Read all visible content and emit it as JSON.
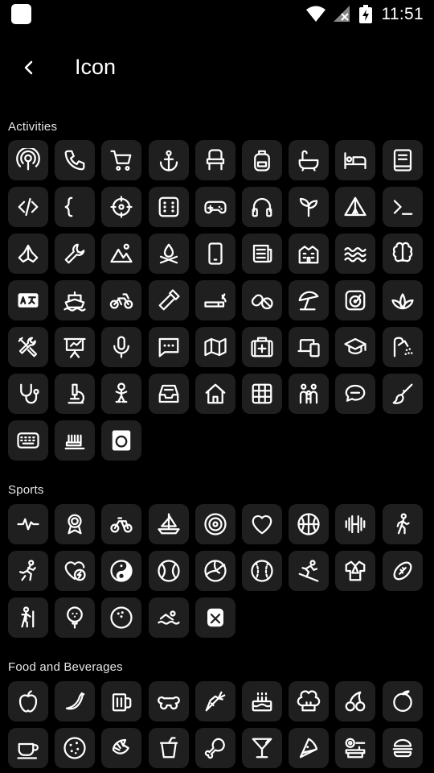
{
  "status_bar": {
    "time": "11:51"
  },
  "app_bar": {
    "title": "Icon"
  },
  "sections": [
    {
      "title": "Activities",
      "icons": [
        "podcast-icon",
        "phone-icon",
        "shopping-cart-icon",
        "anchor-icon",
        "chair-icon",
        "backpack-icon",
        "bathtub-icon",
        "bed-icon",
        "book-icon",
        "code-icon",
        "curly-braces-icon",
        "crosshair-icon",
        "dice-icon",
        "gamepad-icon",
        "headphones-icon",
        "plant-icon",
        "tent-icon",
        "terminal-icon",
        "praying-hands-icon",
        "wrench-icon",
        "mountains-icon",
        "campfire-icon",
        "mobile-phone-icon",
        "newspaper-icon",
        "building-icon",
        "waves-icon",
        "brain-icon",
        "translate-icon",
        "ship-icon",
        "motorcycle-icon",
        "hammer-icon",
        "cigarette-icon",
        "pills-icon",
        "beach-umbrella-icon",
        "vinyl-record-icon",
        "lotus-icon",
        "tools-icon",
        "presentation-icon",
        "microphone-icon",
        "chat-dots-icon",
        "map-icon",
        "first-aid-kit-icon",
        "devices-icon",
        "graduation-cap-icon",
        "shower-icon",
        "stethoscope-icon",
        "microscope-icon",
        "baby-icon",
        "inbox-tray-icon",
        "house-icon",
        "grid-icon",
        "family-icon",
        "chat-bubble-icon",
        "paint-brush-icon",
        "keyboard-icon",
        "toothbrush-icon",
        "washing-machine-icon"
      ]
    },
    {
      "title": "Sports",
      "icons": [
        "heartbeat-icon",
        "medal-icon",
        "bicycle-icon",
        "sailboat-icon",
        "target-icon",
        "heart-icon",
        "basketball-icon",
        "dumbbell-icon",
        "walking-person-icon",
        "running-person-icon",
        "heart-bolt-icon",
        "yin-yang-icon",
        "tennis-ball-icon",
        "volleyball-icon",
        "baseball-icon",
        "skiing-icon",
        "judo-icon",
        "football-icon",
        "hiking-icon",
        "golf-ball-icon",
        "bowling-ball-icon",
        "swimming-icon",
        "boxing-glove-icon"
      ]
    },
    {
      "title": "Food and Beverages",
      "icons": [
        "apple-icon",
        "banana-icon",
        "beer-mug-icon",
        "bone-icon",
        "carrot-icon",
        "cake-icon",
        "chef-hat-icon",
        "cherries-icon",
        "orange-icon",
        "coffee-cup-icon",
        "cookie-icon",
        "croissant-icon",
        "drink-cup-icon",
        "chicken-leg-icon",
        "cocktail-icon",
        "pizza-slice-icon",
        "cooking-icon",
        "hamburger-icon"
      ]
    }
  ]
}
